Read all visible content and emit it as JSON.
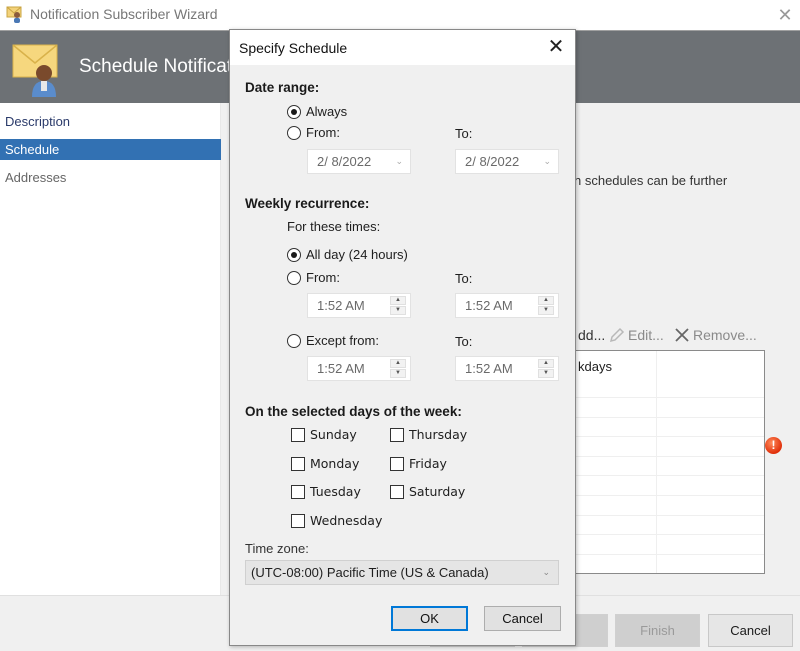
{
  "wizard": {
    "title": "Notification Subscriber Wizard",
    "header_title": "Schedule Notifications",
    "nav": [
      {
        "label": "Description",
        "state": "normal"
      },
      {
        "label": "Schedule",
        "state": "selected"
      },
      {
        "label": "Addresses",
        "state": "normal"
      }
    ],
    "content_text": "n schedules can be further",
    "toolbar": {
      "add_label": "dd...",
      "edit_label": "Edit...",
      "remove_label": "Remove..."
    },
    "schedule_list": {
      "rows": [
        {
          "col1": "kdays",
          "col2": ""
        },
        {
          "col1": "",
          "col2": ""
        },
        {
          "col1": "",
          "col2": ""
        },
        {
          "col1": "",
          "col2": ""
        },
        {
          "col1": "",
          "col2": ""
        },
        {
          "col1": "",
          "col2": ""
        },
        {
          "col1": "",
          "col2": ""
        },
        {
          "col1": "",
          "col2": ""
        },
        {
          "col1": "",
          "col2": ""
        },
        {
          "col1": "",
          "col2": ""
        }
      ]
    },
    "error_icon": "error-icon",
    "buttons": {
      "previous": "",
      "next": ">",
      "finish": "Finish",
      "cancel": "Cancel"
    },
    "close_glyph": "✕"
  },
  "dialog": {
    "title": "Specify Schedule",
    "close_glyph": "✕",
    "date_range": {
      "label": "Date range:",
      "always_label": "Always",
      "always_selected": true,
      "from_label": "From:",
      "from_selected": false,
      "to_label": "To:",
      "from_date": "2/  8/2022",
      "to_date": "2/  8/2022"
    },
    "weekly": {
      "label": "Weekly recurrence:",
      "for_these_times": "For these times:",
      "all_day_label": "All day (24 hours)",
      "all_day_selected": true,
      "from_label": "From:",
      "to_label": "To:",
      "from_time": "1:52 AM",
      "to_time": "1:52 AM",
      "except_label": "Except from:",
      "except_to_label": "To:",
      "except_from_time": "1:52 AM",
      "except_to_time": "1:52 AM"
    },
    "days": {
      "label": "On the selected days of the week:",
      "items": [
        {
          "label": "Sunday",
          "checked": false
        },
        {
          "label": "Monday",
          "checked": false
        },
        {
          "label": "Tuesday",
          "checked": false
        },
        {
          "label": "Wednesday",
          "checked": false
        },
        {
          "label": "Thursday",
          "checked": false
        },
        {
          "label": "Friday",
          "checked": false
        },
        {
          "label": "Saturday",
          "checked": false
        }
      ]
    },
    "timezone": {
      "label": "Time zone:",
      "value": "(UTC-08:00) Pacific Time (US & Canada)"
    },
    "ok_label": "OK",
    "cancel_label": "Cancel"
  },
  "colors": {
    "header_bg": "#6d7175",
    "nav_selected": "#3271b3",
    "ok_focus": "#0078d7",
    "error": "#e0300a"
  }
}
